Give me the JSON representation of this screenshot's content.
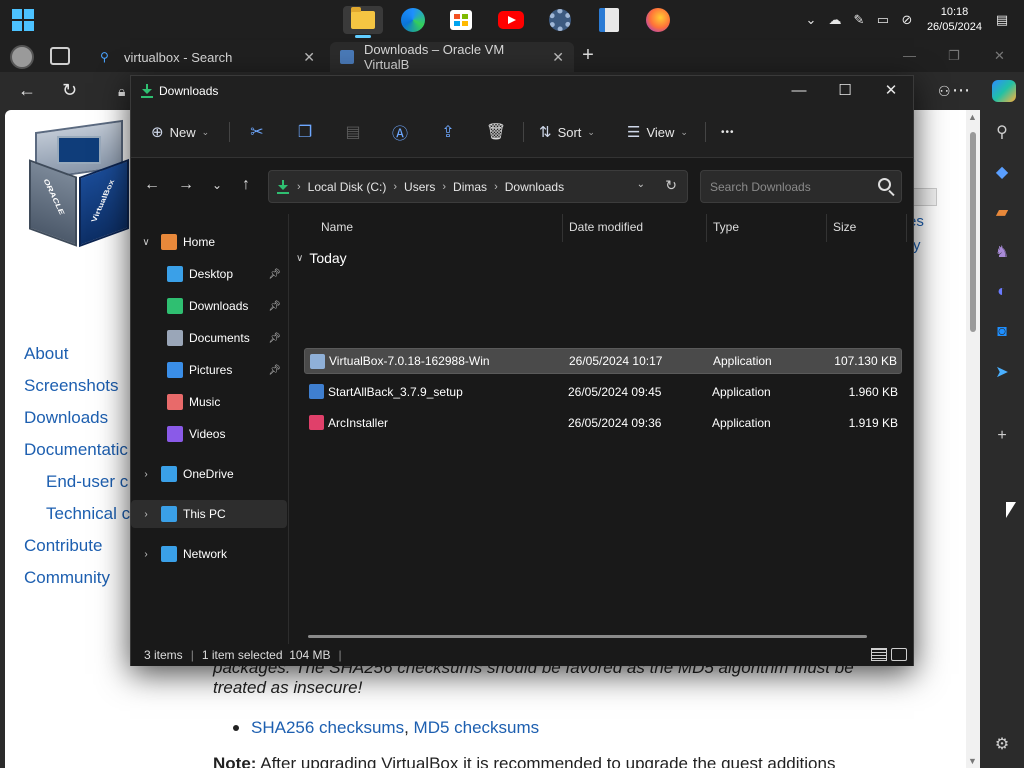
{
  "taskbar": {
    "clock_time": "10:18",
    "clock_date": "26/05/2024",
    "icons": [
      "windows-start-icon",
      "file-explorer-icon",
      "edge-icon",
      "microsoft-store-icon",
      "youtube-icon",
      "settings-icon",
      "notepad-icon",
      "firefox-icon"
    ]
  },
  "browser": {
    "tabs": [
      {
        "label": "virtualbox - Search",
        "icon": "search-icon"
      },
      {
        "label": "Downloads – Oracle VM VirtualB",
        "icon": "virtualbox-favicon"
      }
    ]
  },
  "webpage": {
    "nav_links": [
      {
        "label": "About",
        "sub": false
      },
      {
        "label": "Screenshots",
        "sub": false
      },
      {
        "label": "Downloads",
        "sub": false
      },
      {
        "label": "Documentatic",
        "sub": false
      },
      {
        "label": "End-user c",
        "sub": true
      },
      {
        "label": "Technical c",
        "sub": true
      },
      {
        "label": "Contribute",
        "sub": false
      },
      {
        "label": "Community",
        "sub": false
      }
    ],
    "right_fragment_1": "es",
    "right_fragment_2": "ry",
    "logo_text_left": "ORACLE",
    "logo_text_right": "VirtualBox",
    "body_line_1": "packages. The SHA256 checksums should be favored as the MD5 algorithm must be",
    "body_line_2": "treated as insecure!",
    "link_sha256": "SHA256 checksums",
    "link_separator": ", ",
    "link_md5": "MD5 checksums",
    "note_label": "Note:",
    "note_text": " After upgrading VirtualBox it is recommended to upgrade the guest additions"
  },
  "explorer": {
    "title": "Downloads",
    "toolbar": {
      "new_label": "New",
      "sort_label": "Sort",
      "view_label": "View",
      "more_label": "•••"
    },
    "breadcrumbs": [
      "Local Disk (C:)",
      "Users",
      "Dimas",
      "Downloads"
    ],
    "search_placeholder": "Search Downloads",
    "nav_items": [
      {
        "label": "Home",
        "level": 0,
        "expanded": true,
        "icon": "home-icon",
        "color": "#e8883a"
      },
      {
        "label": "Desktop",
        "level": 1,
        "pinned": true,
        "icon": "desktop-icon",
        "color": "#3aa0e8"
      },
      {
        "label": "Downloads",
        "level": 1,
        "pinned": true,
        "icon": "downloads-icon",
        "color": "#2fbf71"
      },
      {
        "label": "Documents",
        "level": 1,
        "pinned": true,
        "icon": "documents-icon",
        "color": "#9aa6b8"
      },
      {
        "label": "Pictures",
        "level": 1,
        "pinned": true,
        "icon": "pictures-icon",
        "color": "#3a8ee8"
      },
      {
        "label": "Music",
        "level": 1,
        "pinned": false,
        "icon": "music-icon",
        "color": "#e86a6a"
      },
      {
        "label": "Videos",
        "level": 1,
        "pinned": false,
        "icon": "videos-icon",
        "color": "#8a5ae8"
      },
      {
        "label": "OneDrive",
        "level": 0,
        "expanded": false,
        "icon": "onedrive-icon",
        "color": "#3aa0e8"
      },
      {
        "label": "This PC",
        "level": 0,
        "expanded": false,
        "selected": true,
        "icon": "this-pc-icon",
        "color": "#3aa0e8"
      },
      {
        "label": "Network",
        "level": 0,
        "expanded": false,
        "icon": "network-icon",
        "color": "#3aa0e8"
      }
    ],
    "columns": [
      "Name",
      "Date modified",
      "Type",
      "Size"
    ],
    "group_label": "Today",
    "files": [
      {
        "name": "VirtualBox-7.0.18-162988-Win",
        "date": "26/05/2024 10:17",
        "type": "Application",
        "size": "107.130 KB",
        "selected": true,
        "icon": "virtualbox-app-icon",
        "color": "#8fb0d8"
      },
      {
        "name": "StartAllBack_3.7.9_setup",
        "date": "26/05/2024 09:45",
        "type": "Application",
        "size": "1.960 KB",
        "selected": false,
        "icon": "installer-app-icon",
        "color": "#3f7fd0"
      },
      {
        "name": "ArcInstaller",
        "date": "26/05/2024 09:36",
        "type": "Application",
        "size": "1.919 KB",
        "selected": false,
        "icon": "arc-installer-icon",
        "color": "#e0406a"
      }
    ],
    "status": {
      "items": "3 items",
      "selected": "1 item selected  104 MB"
    }
  }
}
